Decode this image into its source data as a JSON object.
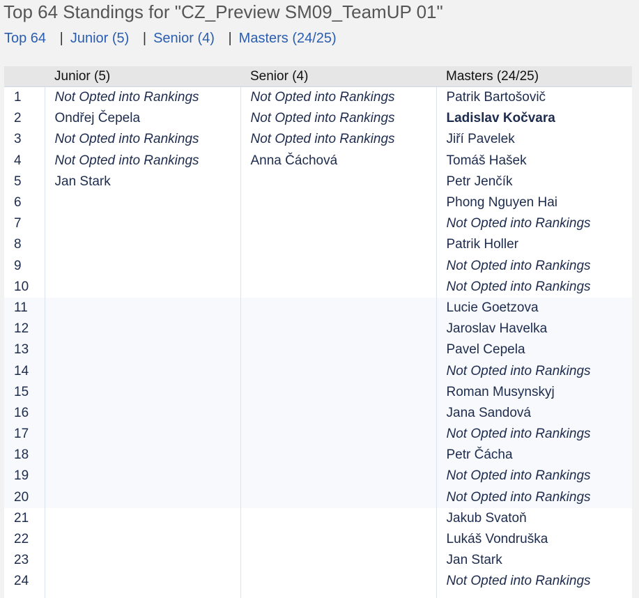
{
  "title": "Top 64 Standings for \"CZ_Preview SM09_TeamUP 01\"",
  "nav": {
    "items": [
      {
        "label": "Top 64"
      },
      {
        "label": "Junior (5)"
      },
      {
        "label": "Senior (4)"
      },
      {
        "label": "Masters (24/25)"
      }
    ],
    "separator": "|"
  },
  "table": {
    "headers": [
      "",
      "Junior (5)",
      "Senior (4)",
      "Masters (24/25)"
    ],
    "rows": [
      {
        "rank": "1",
        "junior": "Not Opted into Rankings",
        "junior_italic": true,
        "senior": "Not Opted into Rankings",
        "senior_italic": true,
        "masters": "Patrik Bartošovič",
        "masters_italic": false
      },
      {
        "rank": "2",
        "junior": "Ondřej Čepela",
        "junior_italic": false,
        "senior": "Not Opted into Rankings",
        "senior_italic": true,
        "masters": "Ladislav Kočvara",
        "masters_italic": false,
        "masters_bold": true
      },
      {
        "rank": "3",
        "junior": "Not Opted into Rankings",
        "junior_italic": true,
        "senior": "Not Opted into Rankings",
        "senior_italic": true,
        "masters": "Jiří Pavelek",
        "masters_italic": false
      },
      {
        "rank": "4",
        "junior": "Not Opted into Rankings",
        "junior_italic": true,
        "senior": "Anna Čáchová",
        "senior_italic": false,
        "masters": "Tomáš Hašek",
        "masters_italic": false
      },
      {
        "rank": "5",
        "junior": "Jan Stark",
        "junior_italic": false,
        "senior": "",
        "masters": "Petr Jenčík",
        "masters_italic": false
      },
      {
        "rank": "6",
        "junior": "",
        "senior": "",
        "masters": "Phong Nguyen Hai",
        "masters_italic": false
      },
      {
        "rank": "7",
        "junior": "",
        "senior": "",
        "masters": "Not Opted into Rankings",
        "masters_italic": true
      },
      {
        "rank": "8",
        "junior": "",
        "senior": "",
        "masters": "Patrik Holler",
        "masters_italic": false
      },
      {
        "rank": "9",
        "junior": "",
        "senior": "",
        "masters": "Not Opted into Rankings",
        "masters_italic": true
      },
      {
        "rank": "10",
        "junior": "",
        "senior": "",
        "masters": "Not Opted into Rankings",
        "masters_italic": true
      },
      {
        "rank": "11",
        "junior": "",
        "senior": "",
        "masters": "Lucie Goetzova",
        "masters_italic": false
      },
      {
        "rank": "12",
        "junior": "",
        "senior": "",
        "masters": "Jaroslav Havelka",
        "masters_italic": false
      },
      {
        "rank": "13",
        "junior": "",
        "senior": "",
        "masters": "Pavel Cepela",
        "masters_italic": false
      },
      {
        "rank": "14",
        "junior": "",
        "senior": "",
        "masters": "Not Opted into Rankings",
        "masters_italic": true
      },
      {
        "rank": "15",
        "junior": "",
        "senior": "",
        "masters": "Roman Musynskyj",
        "masters_italic": false
      },
      {
        "rank": "16",
        "junior": "",
        "senior": "",
        "masters": "Jana Sandová",
        "masters_italic": false
      },
      {
        "rank": "17",
        "junior": "",
        "senior": "",
        "masters": "Not Opted into Rankings",
        "masters_italic": true
      },
      {
        "rank": "18",
        "junior": "",
        "senior": "",
        "masters": "Petr Čácha",
        "masters_italic": false
      },
      {
        "rank": "19",
        "junior": "",
        "senior": "",
        "masters": "Not Opted into Rankings",
        "masters_italic": true
      },
      {
        "rank": "20",
        "junior": "",
        "senior": "",
        "masters": "Not Opted into Rankings",
        "masters_italic": true
      },
      {
        "rank": "21",
        "junior": "",
        "senior": "",
        "masters": "Jakub Svatoň",
        "masters_italic": false
      },
      {
        "rank": "22",
        "junior": "",
        "senior": "",
        "masters": "Lukáš Vondruška",
        "masters_italic": false
      },
      {
        "rank": "23",
        "junior": "",
        "senior": "",
        "masters": "Jan Stark",
        "masters_italic": false
      },
      {
        "rank": "24",
        "junior": "",
        "senior": "",
        "masters": "Not Opted into Rankings",
        "masters_italic": true
      },
      {
        "rank": "",
        "junior": "",
        "senior": "",
        "masters": ""
      }
    ]
  }
}
